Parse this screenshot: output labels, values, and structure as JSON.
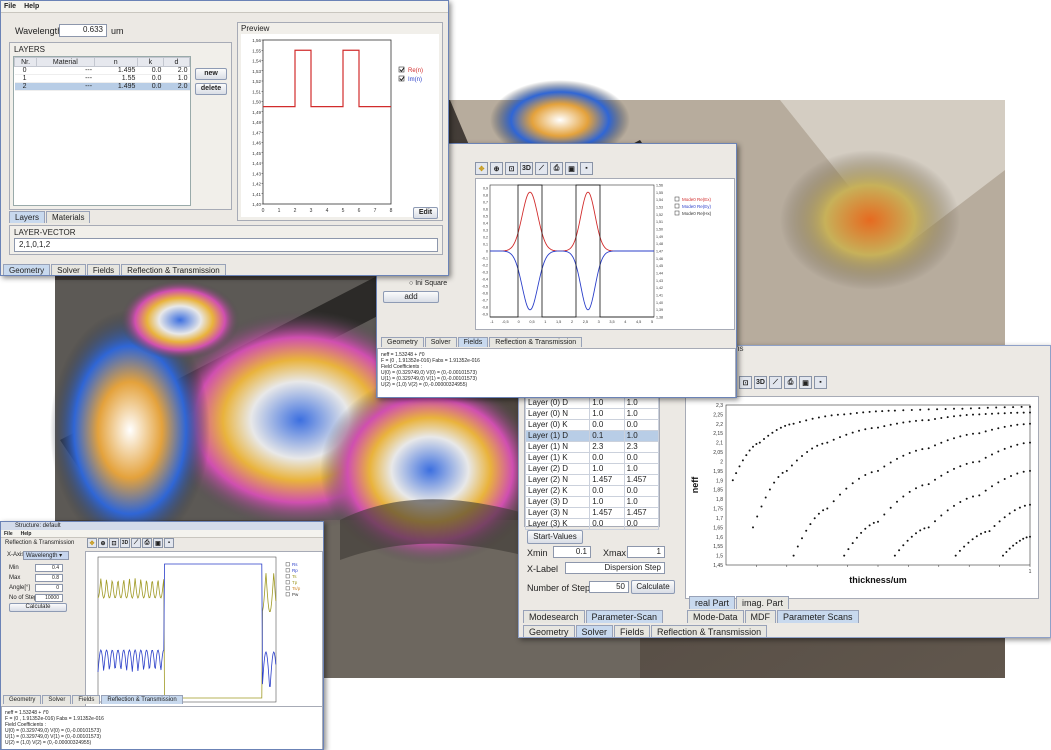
{
  "colors": {
    "window_border": "#6b83b6",
    "selection": "#b8cde6",
    "re_curve": "#d12c2c",
    "im_curve": "#2b3fc9",
    "olive_curve": "#a09a25"
  },
  "w1": {
    "menu": [
      "File",
      "Help"
    ],
    "wavelength": {
      "label": "Wavelength:",
      "value": "0.633",
      "unit": "um"
    },
    "layers_title": "LAYERS",
    "table": {
      "headers": [
        "Nr.",
        "Material",
        "n",
        "k",
        "d"
      ],
      "rows": [
        [
          "0",
          "---",
          "1.495",
          "0.0",
          "2.0"
        ],
        [
          "1",
          "---",
          "1.55",
          "0.0",
          "1.0"
        ],
        [
          "2",
          "---",
          "1.495",
          "0.0",
          "2.0"
        ]
      ]
    },
    "new_btn": "new",
    "delete_btn": "delete",
    "preview": {
      "title": "Preview",
      "ylabels": [
        "1,56",
        "1,55",
        "1,54",
        "1,53",
        "1,52",
        "1,51",
        "1,50",
        "1,49",
        "1,48",
        "1,47",
        "1,46",
        "1,45",
        "1,44",
        "1,43",
        "1,42",
        "1,41",
        "1,40"
      ],
      "xlabels": [
        "0",
        "1",
        "2",
        "3",
        "4",
        "5",
        "6",
        "7",
        "8"
      ],
      "legend": [
        "Re(n)",
        "Im(n)"
      ],
      "edit_btn": "Edit"
    },
    "inner_tabs": [
      "Layers",
      "Materials"
    ],
    "vector": {
      "title": "LAYER-VECTOR",
      "value": "2,1,0,1,2"
    },
    "tabs": [
      "Geometry",
      "Solver",
      "Fields",
      "Reflection & Transmission"
    ]
  },
  "w2": {
    "legend": [
      "Mode0 Re(Ex)",
      "Mode0 Re(Ey)",
      "Mode0 Re(Hx)"
    ],
    "left_ylabels": [
      "0,9",
      "0,8",
      "0,7",
      "0,6",
      "0,5",
      "0,4",
      "0,3",
      "0,2",
      "0,1",
      "0",
      "-0,1",
      "-0,2",
      "-0,3",
      "-0,4",
      "-0,5",
      "-0,6",
      "-0,7",
      "-0,8",
      "-0,9"
    ],
    "right_ylabels": [
      "1,56",
      "1,55",
      "1,54",
      "1,53",
      "1,52",
      "1,51",
      "1,50",
      "1,49",
      "1,48",
      "1,47",
      "1,46",
      "1,45",
      "1,44",
      "1,43",
      "1,42",
      "1,41",
      "1,40",
      "1,39",
      "1,38"
    ],
    "xlabels": [
      "-1",
      "-0,5",
      "0",
      "0,5",
      "1",
      "1,5",
      "2",
      "2,5",
      "3",
      "3,5",
      "4",
      "4,5",
      "5"
    ],
    "ini_square": "Ini Square",
    "add_btn": "add",
    "tabs": [
      "Geometry",
      "Solver",
      "Fields",
      "Reflection & Transmission"
    ],
    "output": [
      "neff = 1.53248 + i*0",
      "F = (0 , 1.91352e-016) Fabs = 1.91352e-016",
      "Field Coefficients :",
      "U(0) = (0.329749,0) V(0) = (0,-0.00101573)",
      "U(1) = (0.329749,0) V(1) = (0,-0.00101573)",
      "U(2) = (1,0) V(2) = (0,-0.00000324955)"
    ]
  },
  "w3": {
    "param_rows": [
      [
        "Layer (0) D",
        "1.0",
        "1.0"
      ],
      [
        "Layer (0) N",
        "1.0",
        "1.0"
      ],
      [
        "Layer (0) K",
        "0.0",
        "0.0"
      ],
      [
        "Layer (1) D",
        "0.1",
        "1.0"
      ],
      [
        "Layer (1) N",
        "2.3",
        "2.3"
      ],
      [
        "Layer (1) K",
        "0.0",
        "0.0"
      ],
      [
        "Layer (2) D",
        "1.0",
        "1.0"
      ],
      [
        "Layer (2) N",
        "1.457",
        "1.457"
      ],
      [
        "Layer (2) K",
        "0.0",
        "0.0"
      ],
      [
        "Layer (3) D",
        "1.0",
        "1.0"
      ],
      [
        "Layer (3) N",
        "1.457",
        "1.457"
      ],
      [
        "Layer (3) K",
        "0.0",
        "0.0"
      ]
    ],
    "partial_row": [
      "",
      "1.0",
      "1.0"
    ],
    "start_values_btn": "Start-Values",
    "xmin": {
      "label": "Xmin",
      "value": "0.1"
    },
    "xmax": {
      "label": "Xmax",
      "value": "1"
    },
    "xlabel": {
      "label": "X-Label",
      "value": "Dispersion Step"
    },
    "steps": {
      "label": "Number of Steps",
      "value": "50"
    },
    "calculate_btn": "Calculate",
    "bottom_tabs_left": [
      "Modesearch",
      "Parameter-Scan"
    ],
    "bottom_tabs_right": [
      "Mode-Data",
      "MDF",
      "Parameter Scans"
    ],
    "tabs": [
      "Geometry",
      "Solver",
      "Fields",
      "Reflection & Transmission"
    ],
    "title_frag": "ns",
    "chart_tabs": [
      "real Part",
      "imag. Part"
    ]
  },
  "w4": {
    "menu": [
      "File",
      "Help"
    ],
    "title": "Structure: default",
    "section": "Reflection & Transmission",
    "xaxis": {
      "label": "X-Axis",
      "value": "Wavelength"
    },
    "min": {
      "label": "Min",
      "value": "0.4"
    },
    "max": {
      "label": "Max",
      "value": "0.8"
    },
    "angle": {
      "label": "Angle[°]",
      "value": "0"
    },
    "steps": {
      "label": "No of Steps",
      "value": "10000"
    },
    "calculate_btn": "Calculate",
    "legend": [
      "Rs",
      "Rp",
      "Ts",
      "Tp",
      "Ts/p",
      "Pw"
    ],
    "tabs": [
      "Geometry",
      "Solver",
      "Fields",
      "Reflection & Transmission"
    ],
    "output": [
      "neff = 1.53248 + i*0",
      "F = (0 , 1.91352e-016) Fabs = 1.91352e-016",
      "Field Coefficients :",
      "U(0) = (0.329749,0) V(0) = (0,-0.00101573)",
      "U(1) = (0.329749,0) V(1) = (0,-0.00101573)",
      "U(2) = (1,0) V(2) = (0,-0.00000324955)"
    ]
  },
  "chart_data": [
    {
      "type": "line",
      "x": [
        0,
        2,
        2,
        3,
        3,
        5,
        5,
        6,
        6,
        8
      ],
      "series": [
        {
          "name": "Re(n)",
          "values": [
            1.495,
            1.495,
            1.55,
            1.55,
            1.495,
            1.495,
            1.55,
            1.55,
            1.495,
            1.495
          ]
        }
      ],
      "xlim": [
        0,
        8
      ],
      "ylim": [
        1.4,
        1.56
      ],
      "grid": false,
      "legend": "top-right"
    },
    {
      "type": "scatter",
      "xlabel": "thickness/um",
      "ylabel": "neff",
      "xlim": [
        0.1,
        1
      ],
      "ylim": [
        1.45,
        2.3
      ],
      "ytick_labels": [
        "2,3",
        "2,25",
        "2,2",
        "2,15",
        "2,1",
        "2,05",
        "2",
        "1,95",
        "1,9",
        "1,85",
        "1,8",
        "1,75",
        "1,7",
        "1,65",
        "1,6",
        "1,55",
        "1,5",
        "1,45"
      ],
      "xtick_labels": [
        "",
        "",
        "",
        "",
        "",
        "",
        "",
        "",
        "",
        "1"
      ],
      "series": [
        {
          "values": [
            [
              0.12,
              1.9
            ],
            [
              0.2,
              2.1
            ],
            [
              0.3,
              2.2
            ],
            [
              0.45,
              2.25
            ],
            [
              0.6,
              2.27
            ],
            [
              0.8,
              2.28
            ],
            [
              1.0,
              2.29
            ]
          ]
        },
        {
          "values": [
            [
              0.18,
              1.65
            ],
            [
              0.28,
              1.95
            ],
            [
              0.4,
              2.1
            ],
            [
              0.55,
              2.18
            ],
            [
              0.7,
              2.22
            ],
            [
              0.85,
              2.25
            ],
            [
              1.0,
              2.26
            ]
          ]
        },
        {
          "values": [
            [
              0.3,
              1.5
            ],
            [
              0.4,
              1.75
            ],
            [
              0.55,
              1.95
            ],
            [
              0.7,
              2.07
            ],
            [
              0.85,
              2.15
            ],
            [
              1.0,
              2.2
            ]
          ]
        },
        {
          "values": [
            [
              0.45,
              1.5
            ],
            [
              0.55,
              1.68
            ],
            [
              0.7,
              1.88
            ],
            [
              0.85,
              2.0
            ],
            [
              1.0,
              2.1
            ]
          ]
        },
        {
          "values": [
            [
              0.6,
              1.5
            ],
            [
              0.7,
              1.65
            ],
            [
              0.85,
              1.82
            ],
            [
              1.0,
              1.95
            ]
          ]
        },
        {
          "values": [
            [
              0.78,
              1.5
            ],
            [
              0.88,
              1.63
            ],
            [
              1.0,
              1.77
            ]
          ]
        },
        {
          "values": [
            [
              0.92,
              1.5
            ],
            [
              1.0,
              1.6
            ]
          ]
        }
      ]
    }
  ]
}
